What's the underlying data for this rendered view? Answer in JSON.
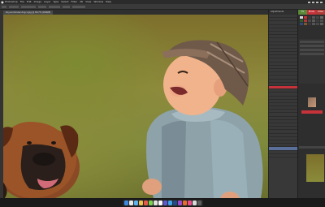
{
  "app": {
    "menu": [
      "Photoshop",
      "File",
      "Edit",
      "Image",
      "Layer",
      "Type",
      "Select",
      "Filter",
      "3D",
      "View",
      "Window",
      "Help"
    ]
  },
  "document": {
    "tab_title": "boy-and-boxer-dog-1.jpg @ 66.7% (RGB/8)"
  },
  "mid_panel": {
    "title": "Adjustments",
    "rows": [
      "",
      "",
      "",
      "",
      "",
      "",
      "",
      "",
      "",
      "",
      "",
      "",
      "",
      "",
      "",
      "",
      "",
      "",
      "",
      "",
      "",
      "",
      "",
      "",
      "",
      "",
      "",
      "",
      "",
      "",
      "",
      "",
      "",
      "",
      "",
      "",
      "",
      "",
      "",
      "",
      "",
      ""
    ]
  },
  "right_dock": {
    "tabs": [
      "TV",
      "Photo",
      "Video"
    ],
    "tab_colors": [
      "#5a8a3a",
      "#c6333a",
      "#b23a36"
    ]
  },
  "colors": {
    "accent_red": "#c6333a",
    "selection_blue": "#5a6f9a"
  }
}
